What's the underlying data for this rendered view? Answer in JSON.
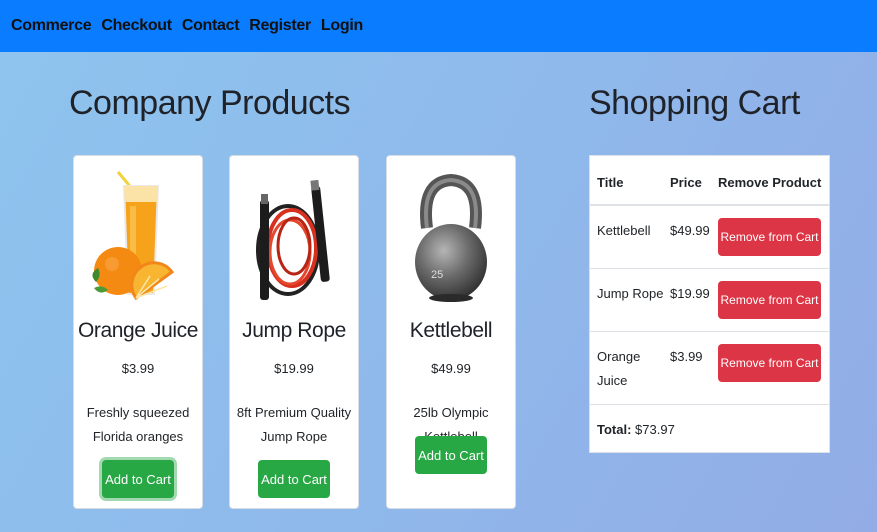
{
  "nav": {
    "items": [
      "Commerce",
      "Checkout",
      "Contact",
      "Register",
      "Login"
    ]
  },
  "products_heading": "Company Products",
  "cart_heading": "Shopping Cart",
  "products": [
    {
      "title": "Orange Juice",
      "price": "$3.99",
      "description": "Freshly squeezed Florida oranges",
      "button": "Add to Cart",
      "icon": "orange-juice-image"
    },
    {
      "title": "Jump Rope",
      "price": "$19.99",
      "description": "8ft Premium Quality Jump Rope",
      "button": "Add to Cart",
      "icon": "jump-rope-image"
    },
    {
      "title": "Kettlebell",
      "price": "$49.99",
      "description": "25lb Olympic Kettlebell",
      "button": "Add to Cart",
      "icon": "kettlebell-image"
    }
  ],
  "cart": {
    "columns": [
      "Title",
      "Price",
      "Remove Product"
    ],
    "rows": [
      {
        "title": "Kettlebell",
        "price": "$49.99",
        "button": "Remove from Cart"
      },
      {
        "title": "Jump Rope",
        "price": "$19.99",
        "button": "Remove from Cart"
      },
      {
        "title": "Orange Juice",
        "price": "$3.99",
        "button": "Remove from Cart"
      }
    ],
    "total_label": "Total:",
    "total_value": "$73.97"
  },
  "colors": {
    "navbar": "#0a7cff",
    "add_button": "#28a745",
    "remove_button": "#dc3545"
  }
}
